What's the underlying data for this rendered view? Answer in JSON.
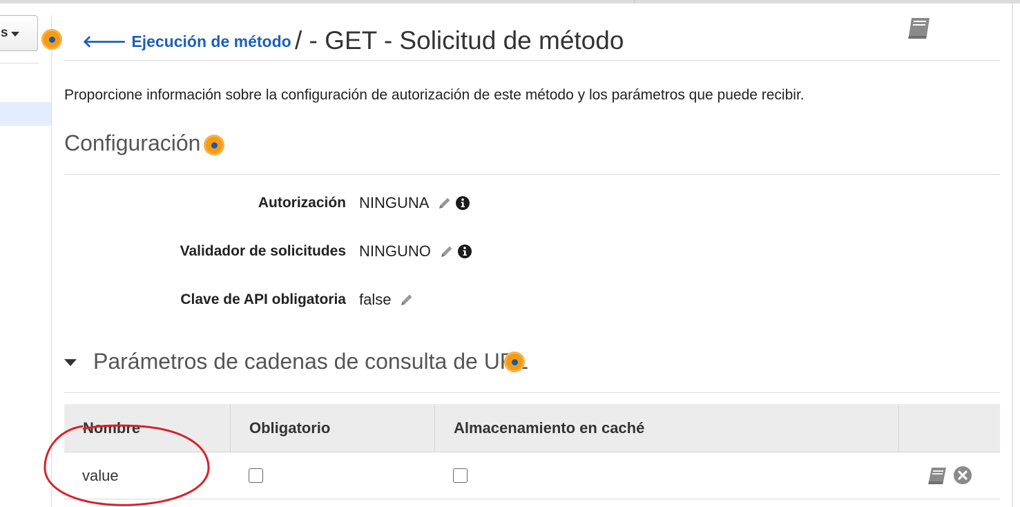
{
  "sidebar": {
    "actions_label": "s"
  },
  "header": {
    "back_link_label": "Ejecución de método",
    "title": "/ - GET - Solicitud de método"
  },
  "intro_text": "Proporcione información sobre la configuración de autorización de este método y los parámetros que puede recibir.",
  "settings": {
    "title": "Configuración",
    "rows": [
      {
        "label": "Autorización",
        "value": "NINGUNA"
      },
      {
        "label": "Validador de solicitudes",
        "value": "NINGUNO"
      },
      {
        "label": "Clave de API obligatoria",
        "value": "false"
      }
    ]
  },
  "query_params": {
    "title": "Parámetros de cadenas de consulta de URL",
    "columns": [
      "Nombre",
      "Obligatorio",
      "Almacenamiento en caché",
      ""
    ],
    "rows": [
      {
        "name": "value",
        "required": false,
        "caching": false
      }
    ]
  },
  "colors": {
    "link": "#1b60b9",
    "info_dot": "#f59b13",
    "annotation": "#d8202a"
  }
}
